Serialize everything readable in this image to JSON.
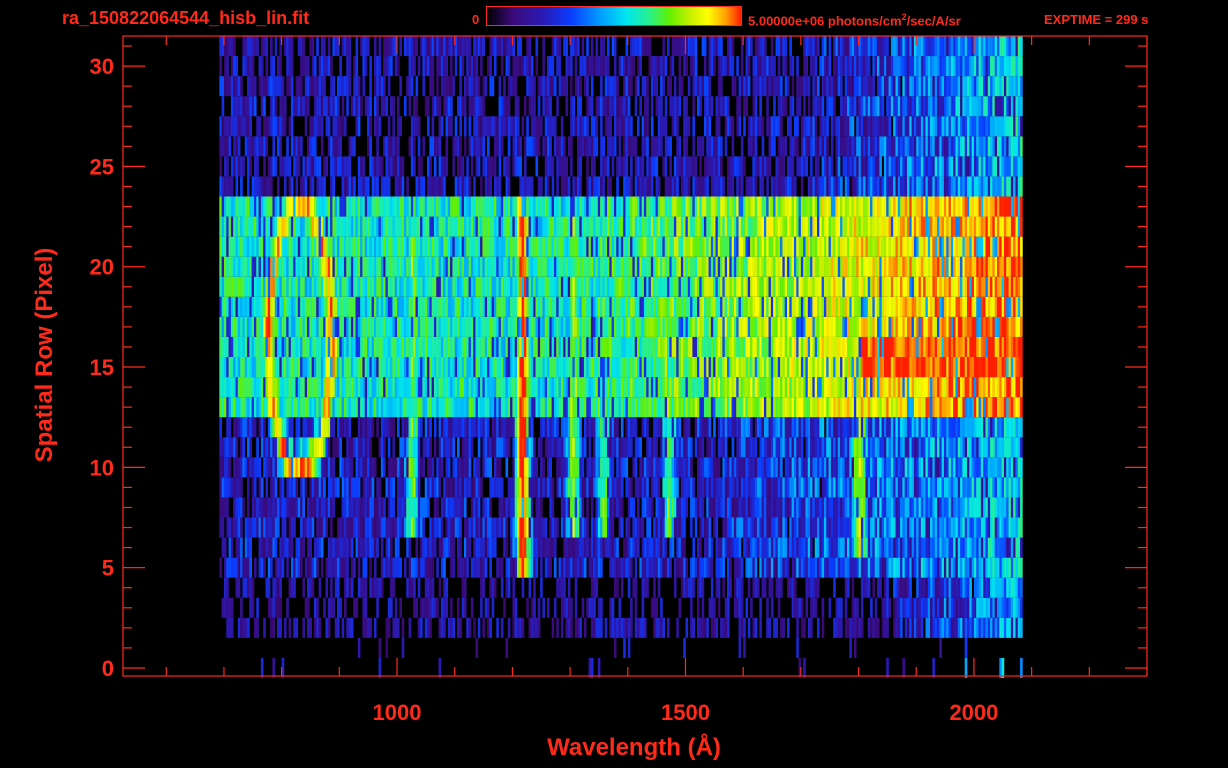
{
  "header": {
    "filename": "ra_150822064544_hisb_lin.fit",
    "colorbar_min_label": "0",
    "colorbar_max_label_prefix": "5.00000e+06 photons/cm",
    "colorbar_max_label_suffix": "/sec/A/sr",
    "colorbar_unit_power": "2",
    "exptime_label": "EXPTIME = 299 s"
  },
  "colors": {
    "axis": "#ff2a1a",
    "background": "#000000",
    "colormap": [
      "#000000",
      "#3a0a78",
      "#2a1ab4",
      "#0a3cff",
      "#00a0ff",
      "#00e6ee",
      "#28f08c",
      "#64f000",
      "#c8f000",
      "#ffff00",
      "#ffa000",
      "#ff1e00"
    ]
  },
  "chart_data": {
    "type": "heatmap",
    "xlabel": "Wavelength (Å)",
    "ylabel": "Spatial Row (Pixel)",
    "xlim": [
      525,
      2300
    ],
    "ylim": [
      -0.4,
      31.5
    ],
    "xticks": [
      1000,
      1500,
      2000
    ],
    "yticks": [
      0,
      5,
      10,
      15,
      20,
      25,
      30
    ],
    "colorbar_range": [
      0,
      5000000
    ],
    "colorbar_units": "photons/cm²/sec/A/sr",
    "exptime_s": 299,
    "rows": [
      0,
      31
    ],
    "wavelength_coverage": [
      690,
      2080
    ],
    "bright_band_rows": [
      13,
      23
    ],
    "features": [
      {
        "wavelength": 1216,
        "rows": [
          5,
          23
        ],
        "relative_intensity": 0.95
      },
      {
        "wavelength": 1304,
        "rows": [
          7,
          23
        ],
        "relative_intensity": 0.55
      },
      {
        "wavelength": 1356,
        "rows": [
          7,
          20
        ],
        "relative_intensity": 0.45
      },
      {
        "wavelength": 1470,
        "rows": [
          7,
          20
        ],
        "relative_intensity": 0.5
      },
      {
        "wavelength": 1800,
        "rows": [
          6,
          12
        ],
        "relative_intensity": 0.55
      },
      {
        "wavelength": 1025,
        "rows": [
          7,
          23
        ],
        "relative_intensity": 0.5
      }
    ]
  }
}
